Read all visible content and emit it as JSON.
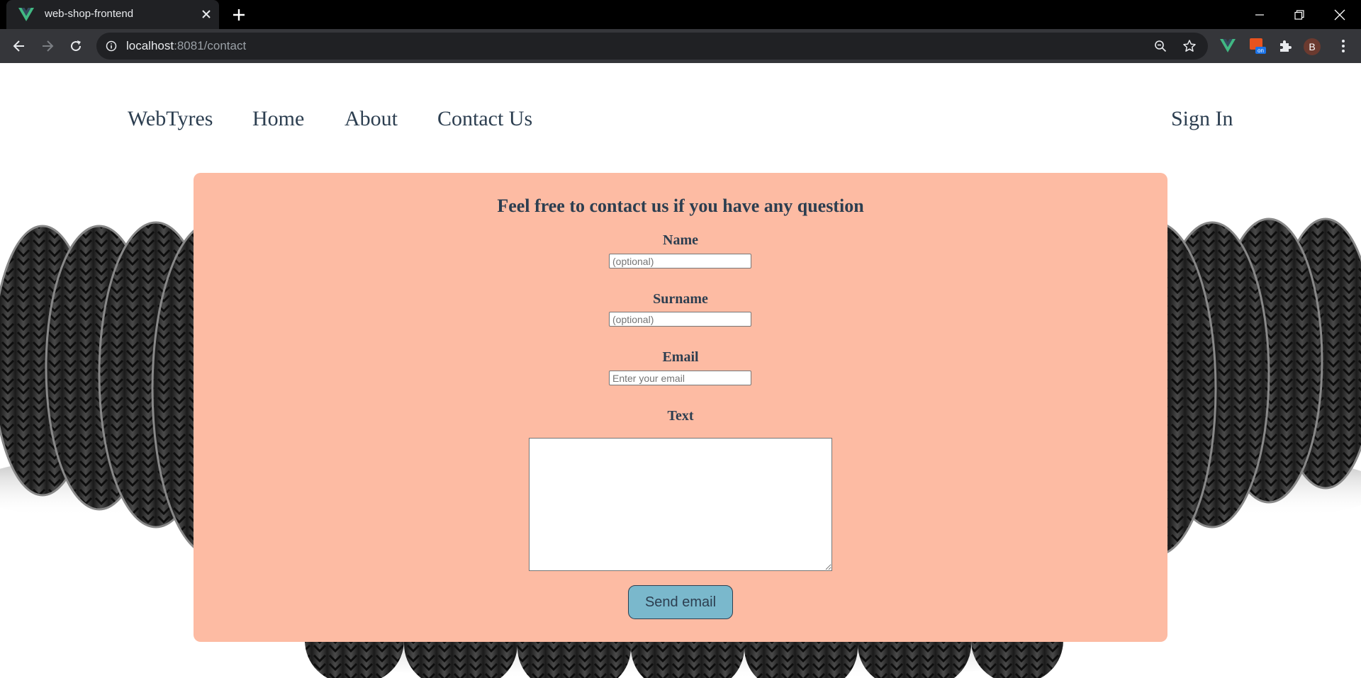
{
  "browser": {
    "tab_title": "web-shop-frontend",
    "url_host": "localhost",
    "url_path": ":8081/contact",
    "profile_initial": "B",
    "icons": [
      "vue-favicon-icon",
      "close-icon",
      "plus-icon",
      "minimize-icon",
      "restore-icon",
      "window-close-icon",
      "back-arrow-icon",
      "forward-arrow-icon",
      "reload-icon",
      "info-icon",
      "zoom-icon",
      "star-icon",
      "vue-devtools-icon",
      "extension-icon",
      "puzzle-icon",
      "kebab-menu-icon"
    ]
  },
  "nav": {
    "brand": "WebTyres",
    "home": "Home",
    "about": "About",
    "contact": "Contact Us",
    "signin": "Sign In"
  },
  "contact_form": {
    "heading": "Feel free to contact us if you have any question",
    "name_label": "Name",
    "name_placeholder": "(optional)",
    "surname_label": "Surname",
    "surname_placeholder": "(optional)",
    "email_label": "Email",
    "email_placeholder": "Enter your email",
    "text_label": "Text",
    "send_label": "Send email"
  },
  "colors": {
    "card_background": "#fdbba3",
    "button_background": "#7ab8cc",
    "text": "#2c3e50"
  }
}
